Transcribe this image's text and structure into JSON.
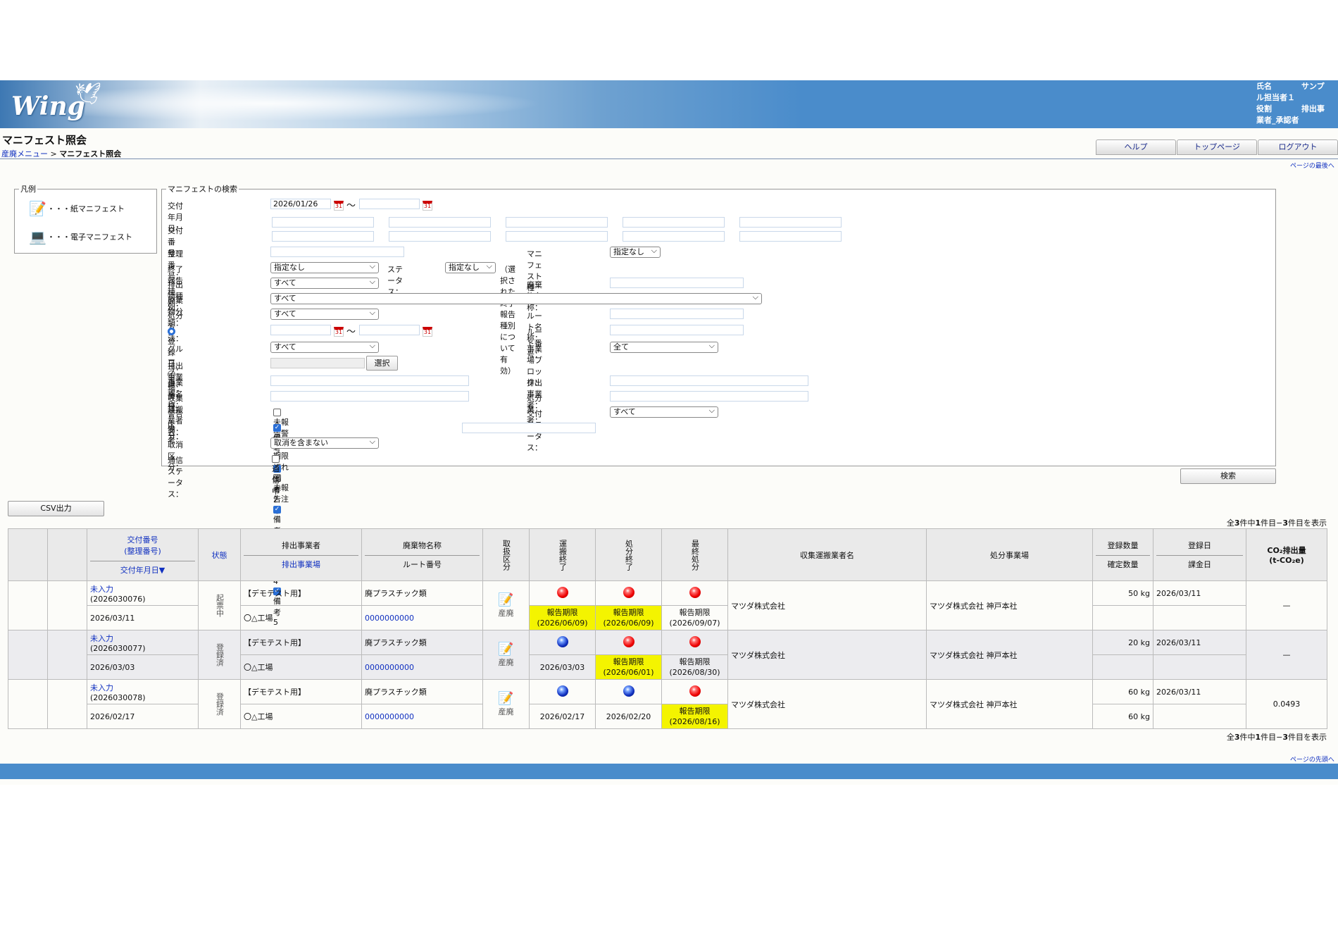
{
  "header": {
    "logo": "Wing",
    "user_info": [
      {
        "k": "氏名",
        "v": "サンプ"
      },
      {
        "k": "ル担当者１",
        "v": ""
      },
      {
        "k": "役割",
        "v": "排出事"
      },
      {
        "k": "業者_承認者",
        "v": ""
      }
    ]
  },
  "page_title": "マニフェスト照会",
  "breadcrumb": {
    "parent": "産廃メニュー",
    "sep": ">",
    "current": "マニフェスト照会"
  },
  "top_buttons": [
    "ヘルプ",
    "トップページ",
    "ログアウト"
  ],
  "links": {
    "to_bottom": "ページの最後へ",
    "to_top": "ページの先頭へ"
  },
  "legend": {
    "title": "凡例",
    "items": [
      {
        "icon": "paper-manifest-icon",
        "label": "・・・紙マニフェスト"
      },
      {
        "icon": "electronic-manifest-icon",
        "label": "・・・電子マニフェスト"
      }
    ]
  },
  "search": {
    "title": "マニフェストの検索",
    "issue_date_label": "交付年月日：",
    "issue_date_from": "2026/01/26",
    "tilde": "〜",
    "issue_no_label": "交付番号：",
    "ref_no_label": "整理番号：",
    "manifest_type_label": "マニフェスト種別：",
    "manifest_type_value": "指定なし",
    "end_report_label": "終了報告種別：",
    "end_report_value": "指定なし",
    "status_label": "ステータス：",
    "status_value": "指定なし",
    "status_note": "（選択された終了報告種別について有効）",
    "emitter_type_label": "排出物種別：",
    "emitter_type_value": "すべて",
    "waste_name_label": "廃棄物名称：",
    "waste_class_label": "廃棄物分類：",
    "waste_class_value": "すべて",
    "disposal_method_label": "処分方法：",
    "disposal_method_value": "すべて",
    "route_name_label": "ルート名称：",
    "reg_date_radio": "登録日",
    "bill_date_radio": "課金日",
    "date_colon": "：",
    "route_no_label": "ルート番号：",
    "group_label": "グループ：",
    "group_value": "すべて",
    "block_label": "事業場ブロック：",
    "block_value": "全て",
    "emit_site_label": "排出事業場：",
    "select_button": "選択",
    "site_name_label": "事業場名称：",
    "emitter_label": "排出事業者：",
    "collector_label": "収集運搬業者名：",
    "disposer_label": "処分業者：",
    "warning_label": "警告区分：",
    "warning_opt1": "未報告警告・期限切れ",
    "warning_opt2": "未報告注意",
    "issue_status_label": "交付ステータス：",
    "issue_status_value": "すべて",
    "remarks_label": "備考：",
    "remarks": [
      "備考1",
      "備考2",
      "備考3",
      "備考4",
      "備考5"
    ],
    "cancel_label": "取消区分：",
    "cancel_value": "取消を含まない",
    "comm_label": "通信ステータス：",
    "comm_opt": "通信中",
    "search_button": "検索"
  },
  "csv_button": "CSV出力",
  "summary": {
    "prefix": "全",
    "total": "3",
    "mid": "件中",
    "from": "1",
    "mid2": "件目−",
    "to": "3",
    "suffix": "件目",
    "tail": "を表示"
  },
  "table": {
    "headers": {
      "issue_no": "交付番号",
      "ref_no": "(整理番号)",
      "issue_date": "交付年月日▼",
      "state": "状態",
      "emitter": "排出事業者",
      "emit_site": "排出事業場",
      "waste": "廃棄物名称",
      "route": "ルート番号",
      "handle": "取扱区分",
      "transport_end": "運搬終了",
      "dispose_end": "処分終了",
      "final_end": "最終処分",
      "collector": "収集運搬業者名",
      "disposer": "処分事業場",
      "reg_qty": "登録数量",
      "conf_qty": "確定数量",
      "reg_date": "登録日",
      "bill_date": "課金日",
      "co2": "CO₂排出量",
      "co2_unit": "(t-CO₂e)"
    },
    "rows": [
      {
        "status": "未入力",
        "ref": "(2026030076)",
        "date": "2026/03/11",
        "state": "起票中",
        "emitter": "【デモテスト用】",
        "site": "〇△工場",
        "waste": "廃プラスチック類",
        "route": "0000000000",
        "handle": "産廃",
        "t_dot": "red",
        "t_text": "報告期限\n(2026/06/09)",
        "t_y": true,
        "d_dot": "red",
        "d_text": "報告期限\n(2026/06/09)",
        "d_y": true,
        "f_dot": "red",
        "f_text": "報告期限\n(2026/09/07)",
        "f_y": false,
        "collector": "マツダ株式会社",
        "disposer": "マツダ株式会社 神戸本社",
        "qty": "50 kg",
        "cqty": "",
        "regd": "2026/03/11",
        "billd": "",
        "co2": "—"
      },
      {
        "status": "未入力",
        "ref": "(2026030077)",
        "date": "2026/03/03",
        "state": "登録済",
        "emitter": "【デモテスト用】",
        "site": "〇△工場",
        "waste": "廃プラスチック類",
        "route": "0000000000",
        "handle": "産廃",
        "t_dot": "blue",
        "t_text": "2026/03/03",
        "t_y": false,
        "d_dot": "red",
        "d_text": "報告期限\n(2026/06/01)",
        "d_y": true,
        "f_dot": "red",
        "f_text": "報告期限\n(2026/08/30)",
        "f_y": false,
        "collector": "マツダ株式会社",
        "disposer": "マツダ株式会社 神戸本社",
        "qty": "20 kg",
        "cqty": "",
        "regd": "2026/03/11",
        "billd": "",
        "co2": "—"
      },
      {
        "status": "未入力",
        "ref": "(2026030078)",
        "date": "2026/02/17",
        "state": "登録済",
        "emitter": "【デモテスト用】",
        "site": "〇△工場",
        "waste": "廃プラスチック類",
        "route": "0000000000",
        "handle": "産廃",
        "t_dot": "blue",
        "t_text": "2026/02/17",
        "t_y": false,
        "d_dot": "blue",
        "d_text": "2026/02/20",
        "d_y": false,
        "f_dot": "red",
        "f_text": "報告期限\n(2026/08/16)",
        "f_y": true,
        "collector": "マツダ株式会社",
        "disposer": "マツダ株式会社 神戸本社",
        "qty": "60 kg",
        "cqty": "60 kg",
        "regd": "2026/03/11",
        "billd": "",
        "co2": "0.0493"
      }
    ]
  }
}
